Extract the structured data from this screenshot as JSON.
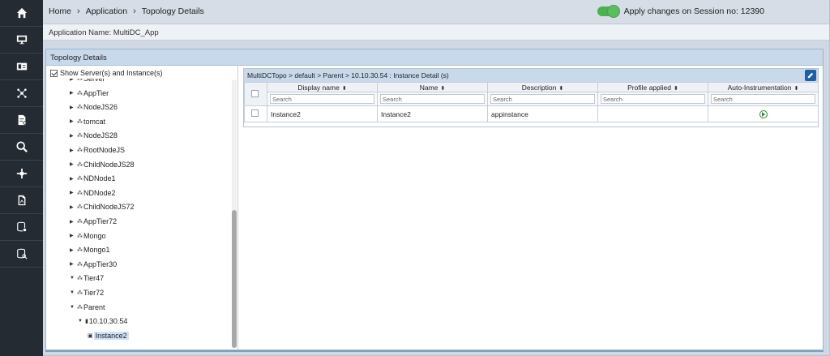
{
  "nav": {
    "icons": [
      "home-icon",
      "monitor-icon",
      "id-card-icon",
      "topology-icon",
      "document-settings-icon",
      "search-zoom-icon",
      "settings-hub-icon",
      "file-report-icon",
      "database-settings-icon",
      "database-search-icon"
    ]
  },
  "header": {
    "breadcrumb": [
      "Home",
      "Application",
      "Topology Details"
    ],
    "session_label": "Apply changes on Session no: 12390",
    "app_name": "Application Name: MultiDC_App"
  },
  "panel": {
    "title": "Topology Details",
    "show_server_label": "Show Server(s) and Instance(s)"
  },
  "tree": {
    "items": [
      {
        "label": "Server",
        "expanded": false,
        "partial": true
      },
      {
        "label": "AppTier",
        "expanded": false
      },
      {
        "label": "NodeJS26",
        "expanded": false
      },
      {
        "label": "tomcat",
        "expanded": false
      },
      {
        "label": "NodeJS28",
        "expanded": false
      },
      {
        "label": "RootNodeJS",
        "expanded": false
      },
      {
        "label": "ChildNodeJS28",
        "expanded": false
      },
      {
        "label": "NDNode1",
        "expanded": false
      },
      {
        "label": "NDNode2",
        "expanded": false
      },
      {
        "label": "ChildNodeJS72",
        "expanded": false
      },
      {
        "label": "AppTier72",
        "expanded": false
      },
      {
        "label": "Mongo",
        "expanded": false
      },
      {
        "label": "Mongo1",
        "expanded": false
      },
      {
        "label": "AppTier30",
        "expanded": false
      },
      {
        "label": "Tier47",
        "expanded": true
      },
      {
        "label": "Tier72",
        "expanded": true
      },
      {
        "label": "Parent",
        "expanded": true
      },
      {
        "label": "10.10.30.54",
        "expanded": true,
        "level": 2
      },
      {
        "label": "Instance2",
        "level": 3,
        "selected": true
      }
    ]
  },
  "grid": {
    "title": "MultiDCTopo > default > Parent > 10.10.30.54 : Instance Detail (s)",
    "columns": [
      "Display name",
      "Name",
      "Description",
      "Profile applied",
      "Auto-Instrumentation"
    ],
    "search_placeholder": "Search",
    "rows": [
      {
        "display_name": "Instance2",
        "name": "Instance2",
        "description": "appinstance",
        "profile": ""
      }
    ]
  },
  "colors": {
    "nav_bg": "#252b33",
    "header_bg": "#d6dde6",
    "panel_head": "#c9d9ec",
    "toggle_on": "#4caf50",
    "edit_button": "#1f5fa8",
    "play_green": "#2e8b2e"
  }
}
